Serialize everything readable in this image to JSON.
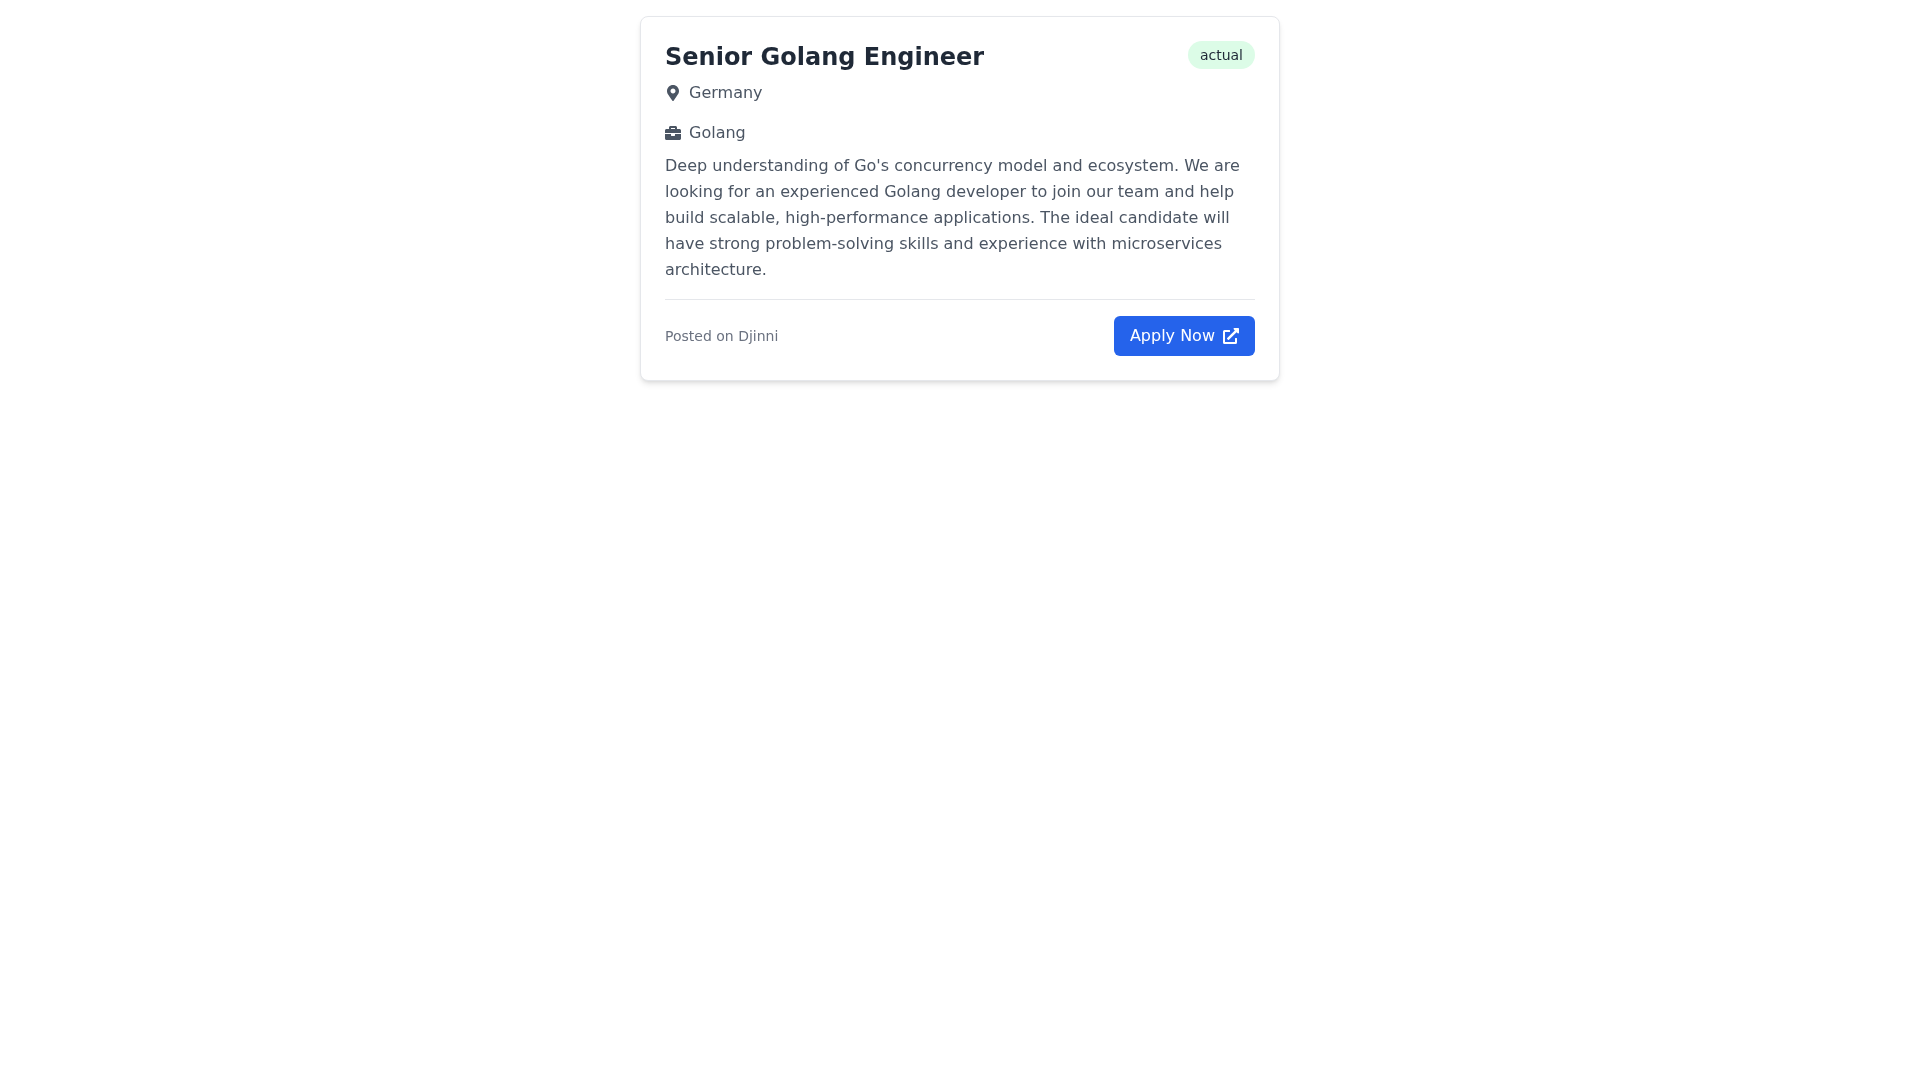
{
  "job_card": {
    "title": "Senior Golang Engineer",
    "status_badge": "actual",
    "location": "Germany",
    "category": "Golang",
    "description": "Deep understanding of Go's concurrency model and ecosystem. We are looking for an experienced Golang developer to join our team and help build scalable, high-performance applications. The ideal candidate will have strong problem-solving skills and experience with microservices architecture.",
    "source": "Posted on Djinni",
    "apply_button": "Apply Now"
  }
}
